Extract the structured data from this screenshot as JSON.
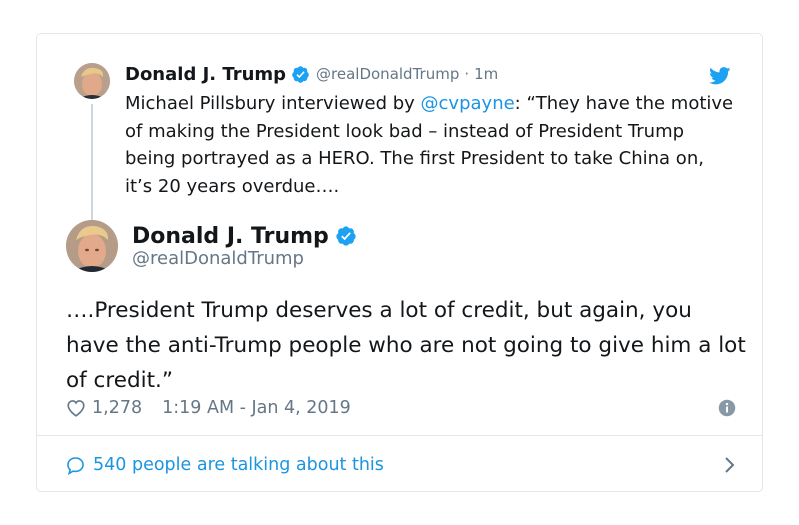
{
  "colors": {
    "accent": "#1b95e0",
    "muted": "#657786",
    "text": "#14171a",
    "border": "#e1e8ed"
  },
  "parent_tweet": {
    "name": "Donald J. Trump",
    "handle": "@realDonaldTrump",
    "separator": "·",
    "time": "1m",
    "text_before": "Michael Pillsbury interviewed by ",
    "mention": "@cvpayne",
    "text_after": ": “They have the motive of making the President look bad – instead of President Trump being portrayed as a HERO. The first President to take China on, it’s 20 years overdue….",
    "icons": [
      "avatar",
      "verified-icon",
      "twitter-bird-icon"
    ]
  },
  "main_tweet": {
    "name": "Donald J. Trump",
    "handle": "@realDonaldTrump",
    "text": "….President Trump deserves a lot of credit, but again, you have the anti-Trump people who are not going to give him a lot of credit.”",
    "likes": "1,278",
    "timestamp": "1:19 AM - Jan 4, 2019",
    "icons": [
      "heart-icon",
      "info-icon"
    ]
  },
  "footer": {
    "talking": "540 people are talking about this",
    "icons": [
      "speech-bubble-icon",
      "chevron-right-icon"
    ]
  }
}
